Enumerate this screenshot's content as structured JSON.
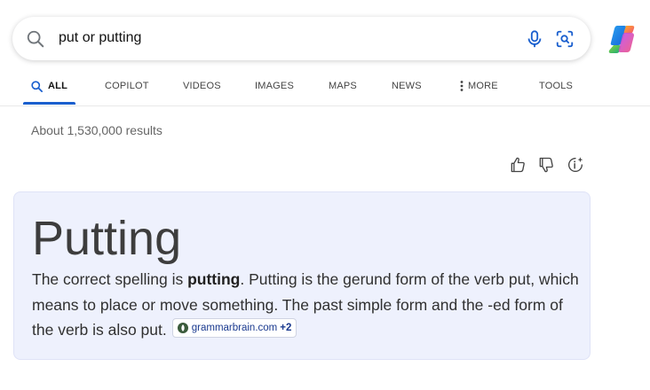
{
  "search": {
    "query": "put or putting"
  },
  "tabs": [
    {
      "label": "ALL",
      "active": true
    },
    {
      "label": "COPILOT",
      "active": false
    },
    {
      "label": "VIDEOS",
      "active": false
    },
    {
      "label": "IMAGES",
      "active": false
    },
    {
      "label": "MAPS",
      "active": false
    },
    {
      "label": "NEWS",
      "active": false
    },
    {
      "label": "MORE",
      "active": false
    },
    {
      "label": "TOOLS",
      "active": false
    }
  ],
  "results_count": "About 1,530,000 results",
  "answer": {
    "title": "Putting",
    "text_before": "The correct spelling is ",
    "text_bold": "putting",
    "text_after": ". Putting is the gerund form of the verb put, which means to place or move something. The past simple form and the -ed form of the verb is also put.",
    "source_name": "grammarbrain.com",
    "source_extra": "+2"
  },
  "icons": {
    "search": "search-icon",
    "mic": "mic-icon",
    "visual_search": "visual-search-icon",
    "copilot": "copilot-logo",
    "thumbs_up": "thumbs-up-icon",
    "thumbs_down": "thumbs-down-icon",
    "info": "info-sparkle-icon",
    "more": "vertical-dots-icon"
  },
  "colors": {
    "accent": "#1a5fce",
    "card_bg": "#eef1fd",
    "source_link": "#1a3a8f"
  }
}
